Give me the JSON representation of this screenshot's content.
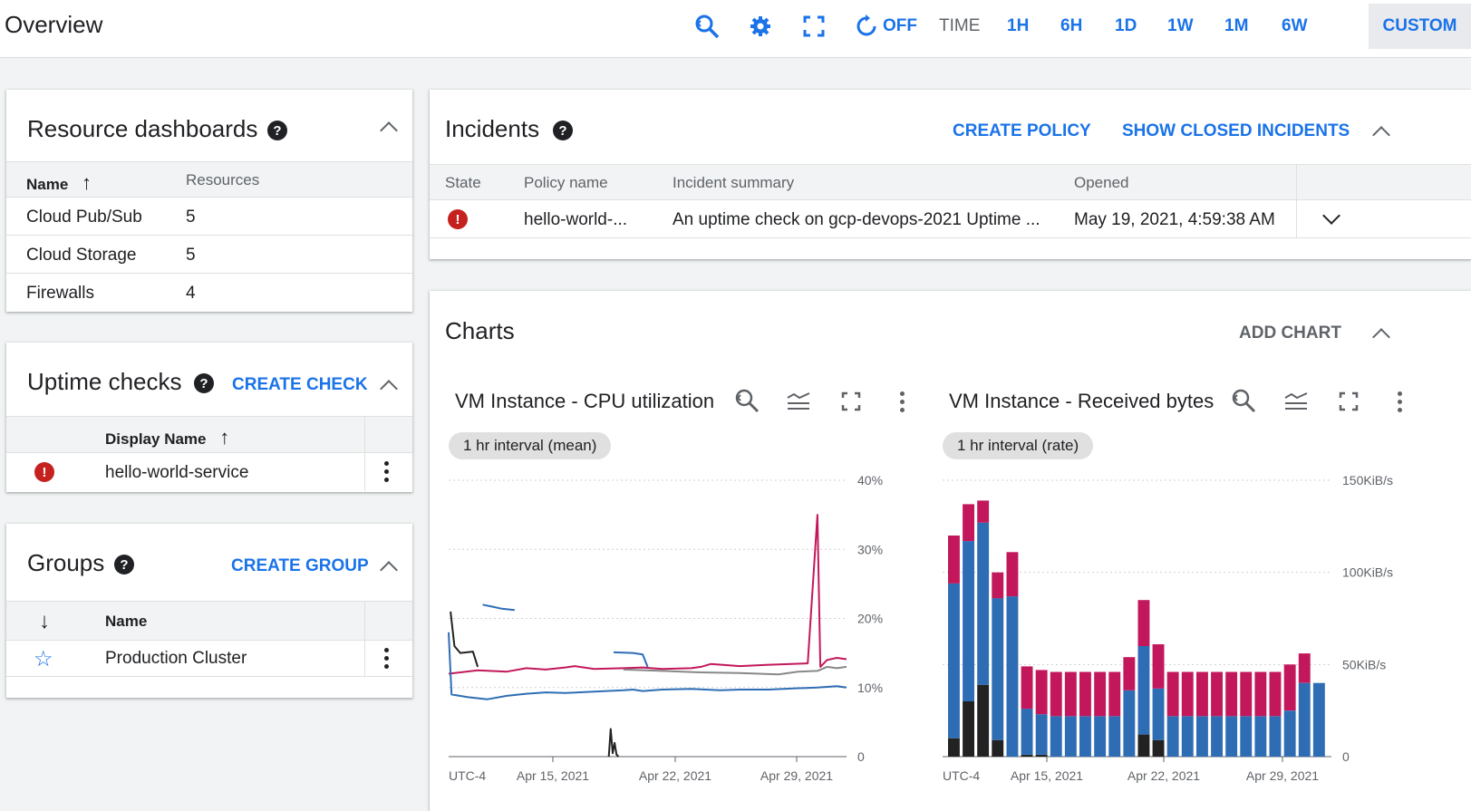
{
  "header": {
    "title": "Overview",
    "auto_refresh_label": "OFF",
    "time_label": "TIME",
    "ranges": [
      "1H",
      "6H",
      "1D",
      "1W",
      "1M",
      "6W"
    ],
    "custom_label": "CUSTOM"
  },
  "resource_dashboards": {
    "title": "Resource dashboards",
    "columns": {
      "name": "Name",
      "resources": "Resources"
    },
    "rows": [
      {
        "name": "Cloud Pub/Sub",
        "count": "5"
      },
      {
        "name": "Cloud Storage",
        "count": "5"
      },
      {
        "name": "Firewalls",
        "count": "4"
      }
    ]
  },
  "uptime_checks": {
    "title": "Uptime checks",
    "create_label": "CREATE CHECK",
    "columns": {
      "display_name": "Display Name"
    },
    "rows": [
      {
        "name": "hello-world-service",
        "status": "error"
      }
    ]
  },
  "groups": {
    "title": "Groups",
    "create_label": "CREATE GROUP",
    "columns": {
      "name": "Name"
    },
    "rows": [
      {
        "name": "Production Cluster"
      }
    ]
  },
  "incidents": {
    "title": "Incidents",
    "create_policy_label": "CREATE POLICY",
    "show_closed_label": "SHOW CLOSED INCIDENTS",
    "columns": {
      "state": "State",
      "policy": "Policy name",
      "summary": "Incident summary",
      "opened": "Opened"
    },
    "rows": [
      {
        "state": "error",
        "policy": "hello-world-...",
        "summary": "An uptime check on gcp-devops-2021 Uptime ...",
        "opened": "May 19, 2021, 4:59:38 AM"
      }
    ]
  },
  "charts": {
    "title": "Charts",
    "add_label": "ADD CHART",
    "colors": {
      "blue": "#2e6db4",
      "pink": "#c2185b",
      "black": "#222222",
      "grey": "#888888"
    }
  },
  "chart_data": [
    {
      "type": "line",
      "title": "VM Instance - CPU utilization",
      "chip": "1 hr interval (mean)",
      "y_ticks": [
        "40%",
        "30%",
        "20%",
        "10%",
        "0"
      ],
      "x_ticks": [
        "UTC-4",
        "Apr 15, 2021",
        "Apr 22, 2021",
        "Apr 29, 2021"
      ],
      "ylim": [
        0,
        40
      ],
      "series": [
        {
          "color": "#c2185b",
          "values": [
            [
              0,
              12
            ],
            [
              3,
              12.5
            ],
            [
              6,
              12.3
            ],
            [
              8,
              12.8
            ],
            [
              10,
              12.6
            ],
            [
              12,
              12.9
            ],
            [
              13,
              13.1
            ],
            [
              15,
              12.7
            ],
            [
              18,
              12.8
            ],
            [
              20,
              12.9
            ],
            [
              22,
              12.7
            ],
            [
              25,
              12.8
            ],
            [
              26,
              13
            ],
            [
              27,
              13.4
            ],
            [
              30,
              13.1
            ],
            [
              33,
              13.3
            ],
            [
              37,
              13.5
            ],
            [
              38,
              35
            ],
            [
              38.3,
              13
            ],
            [
              39,
              14
            ],
            [
              40,
              14.3
            ],
            [
              41,
              14.1
            ]
          ]
        },
        {
          "color": "#2e6db4",
          "values": [
            [
              0,
              18
            ],
            [
              0.3,
              9
            ],
            [
              2,
              8.6
            ],
            [
              4,
              8.3
            ],
            [
              6,
              8.8
            ],
            [
              8,
              9.1
            ],
            [
              10,
              9.3
            ],
            [
              12,
              9.2
            ],
            [
              15,
              9.4
            ],
            [
              18,
              9.6
            ],
            [
              19,
              9.7
            ],
            [
              20,
              9.5
            ],
            [
              22,
              9.7
            ],
            [
              25,
              9.8
            ],
            [
              28,
              9.6
            ],
            [
              30,
              9.7
            ],
            [
              33,
              9.7
            ],
            [
              36,
              9.9
            ],
            [
              38,
              10
            ],
            [
              40,
              10.2
            ],
            [
              41,
              10
            ]
          ]
        },
        {
          "color": "#2e6db4",
          "values": [
            [
              3.5,
              22
            ],
            [
              4.5,
              21.7
            ],
            [
              5.5,
              21.4
            ],
            [
              6.8,
              21.2
            ]
          ]
        },
        {
          "color": "#2e6db4",
          "values": [
            [
              17,
              15.1
            ],
            [
              19,
              15
            ],
            [
              20,
              14.8
            ],
            [
              20.5,
              13
            ]
          ]
        },
        {
          "color": "#888888",
          "values": [
            [
              18,
              12.6
            ],
            [
              22,
              12.4
            ],
            [
              26,
              12.2
            ],
            [
              30,
              12.1
            ],
            [
              34,
              11.9
            ],
            [
              36,
              12.3
            ],
            [
              38,
              12.4
            ],
            [
              39,
              13
            ],
            [
              40,
              12.8
            ],
            [
              41,
              13
            ]
          ]
        },
        {
          "color": "#222222",
          "values": [
            [
              0.2,
              21
            ],
            [
              0.6,
              16
            ],
            [
              1.2,
              15
            ],
            [
              2.5,
              15.2
            ],
            [
              3,
              13
            ]
          ]
        },
        {
          "color": "#222222",
          "values": [
            [
              16.5,
              0
            ],
            [
              16.7,
              4
            ],
            [
              16.9,
              0.5
            ],
            [
              17.1,
              2
            ],
            [
              17.3,
              0.3
            ],
            [
              17.5,
              0
            ]
          ]
        }
      ]
    },
    {
      "type": "bar",
      "title": "VM Instance - Received bytes",
      "chip": "1 hr interval (rate)",
      "y_ticks": [
        "150KiB/s",
        "100KiB/s",
        "50KiB/s",
        "0"
      ],
      "x_ticks": [
        "UTC-4",
        "Apr 15, 2021",
        "Apr 22, 2021",
        "Apr 29, 2021"
      ],
      "ylim": [
        0,
        150
      ],
      "series": [
        {
          "name": "blue",
          "color": "#2e6db4",
          "values": [
            84,
            87,
            88,
            77,
            87,
            25,
            22,
            22,
            22,
            22,
            22,
            22,
            36,
            48,
            28,
            22,
            22,
            22,
            22,
            22,
            22,
            22,
            22,
            25,
            40,
            40
          ]
        },
        {
          "name": "pink",
          "color": "#c2185b",
          "values": [
            26,
            20,
            12,
            14,
            24,
            23,
            24,
            24,
            24,
            24,
            24,
            24,
            18,
            25,
            24,
            24,
            24,
            24,
            24,
            24,
            24,
            24,
            24,
            25,
            16,
            0
          ]
        },
        {
          "name": "black",
          "color": "#222222",
          "values": [
            10,
            30,
            39,
            9,
            0,
            1,
            1,
            0,
            0,
            0,
            0,
            0,
            0,
            12,
            9,
            0,
            0,
            0,
            0,
            0,
            0,
            0,
            0,
            0,
            0,
            0
          ]
        }
      ]
    }
  ]
}
